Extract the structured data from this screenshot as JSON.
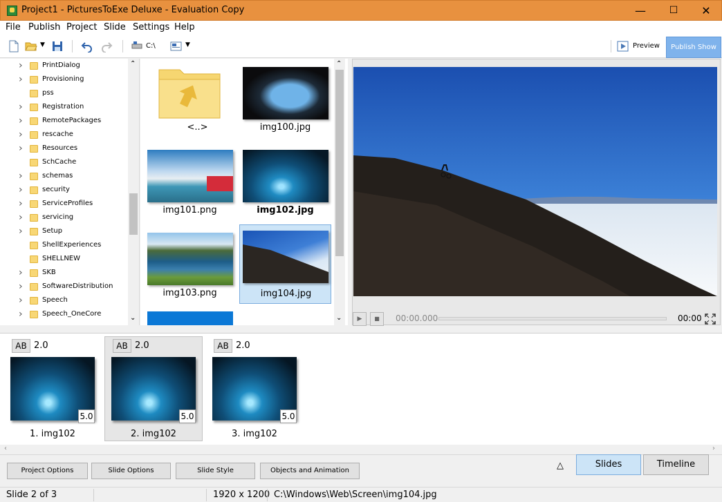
{
  "window": {
    "title": "Project1 - PicturesToExe Deluxe - Evaluation Copy",
    "minimize": "—",
    "maximize": "☐",
    "close": "✕"
  },
  "menu": [
    "File",
    "Publish",
    "Project",
    "Slide",
    "Settings",
    "Help"
  ],
  "toolbar": {
    "path_label": "C:\\",
    "preview_label": "Preview",
    "publish_label": "Publish Show"
  },
  "tree": {
    "items": [
      "PrintDialog",
      "Provisioning",
      "pss",
      "Registration",
      "RemotePackages",
      "rescache",
      "Resources",
      "SchCache",
      "schemas",
      "security",
      "ServiceProfiles",
      "servicing",
      "Setup",
      "ShellExperiences",
      "SHELLNEW",
      "SKB",
      "SoftwareDistribution",
      "Speech",
      "Speech_OneCore"
    ],
    "expandable": [
      true,
      true,
      false,
      true,
      true,
      true,
      true,
      false,
      true,
      true,
      true,
      true,
      true,
      false,
      false,
      true,
      true,
      true,
      true
    ]
  },
  "files": [
    {
      "name": "<..>",
      "kind": "folder"
    },
    {
      "name": "img100.jpg",
      "kind": "image"
    },
    {
      "name": "img101.png",
      "kind": "image"
    },
    {
      "name": "img102.jpg",
      "kind": "image",
      "bold": true
    },
    {
      "name": "img103.png",
      "kind": "image"
    },
    {
      "name": "img104.jpg",
      "kind": "image",
      "selected": true
    }
  ],
  "player": {
    "current_time": "00:00.000",
    "total_time": "00:00"
  },
  "slides": [
    {
      "transition": "AB",
      "transition_time": "2.0",
      "duration": "5.0",
      "caption": "1. img102"
    },
    {
      "transition": "AB",
      "transition_time": "2.0",
      "duration": "5.0",
      "caption": "2. img102",
      "selected": true
    },
    {
      "transition": "AB",
      "transition_time": "2.0",
      "duration": "5.0",
      "caption": "3. img102"
    }
  ],
  "bottom_buttons": [
    "Project Options",
    "Slide Options",
    "Slide Style",
    "Objects and Animation"
  ],
  "view_tabs": {
    "collapse": "△",
    "slides": "Slides",
    "timeline": "Timeline"
  },
  "status": {
    "slide": "Slide 2 of 3",
    "resolution": "1920 x 1200",
    "path": "C:\\Windows\\Web\\Screen\\img104.jpg"
  },
  "colors": {
    "titlebar": "#e8913f",
    "selection": "#cce4f7",
    "accent": "#7fb3ec"
  }
}
